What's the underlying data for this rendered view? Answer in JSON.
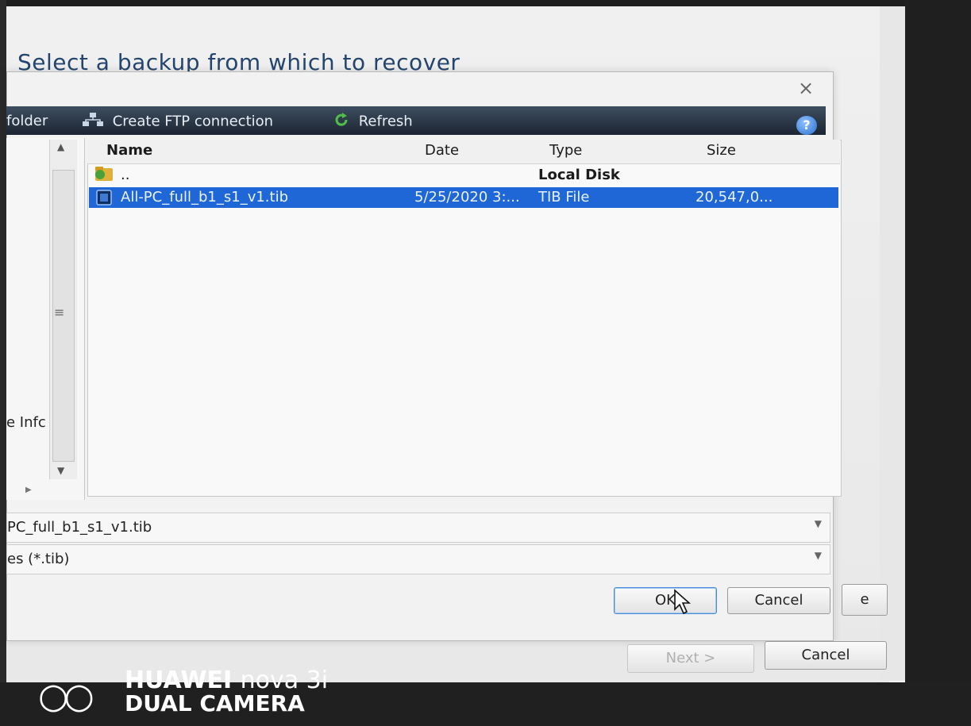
{
  "wizard": {
    "heading": "Select a backup from which to recover",
    "next_label": "Next >",
    "cancel_label": "Cancel",
    "partial_button_text": "e"
  },
  "dialog": {
    "toolbar": {
      "new_folder_label": "folder",
      "ftp_label": "Create FTP connection",
      "refresh_label": "Refresh"
    },
    "left_pane": {
      "partial_text": "e Infc"
    },
    "list": {
      "headers": [
        "Name",
        "Date",
        "Type",
        "Size"
      ],
      "rows": [
        {
          "name": "..",
          "date": "",
          "type": "Local Disk",
          "size": ""
        },
        {
          "name": "All-PC_full_b1_s1_v1.tib",
          "date": "5/25/2020 3:...",
          "type": "TIB File",
          "size": "20,547,0..."
        }
      ],
      "selected_index": 1
    },
    "filename_value": "PC_full_b1_s1_v1.tib",
    "filetype_value": "es (*.tib)",
    "ok_label": "OK",
    "cancel_label": "Cancel"
  },
  "watermark": {
    "brand": "HUAWEI",
    "model": "nova 3i",
    "camera": "DUAL CAMERA"
  },
  "colors": {
    "toolbar_bg": "#2a3442",
    "selection": "#1f67d6",
    "heading": "#24466e"
  }
}
